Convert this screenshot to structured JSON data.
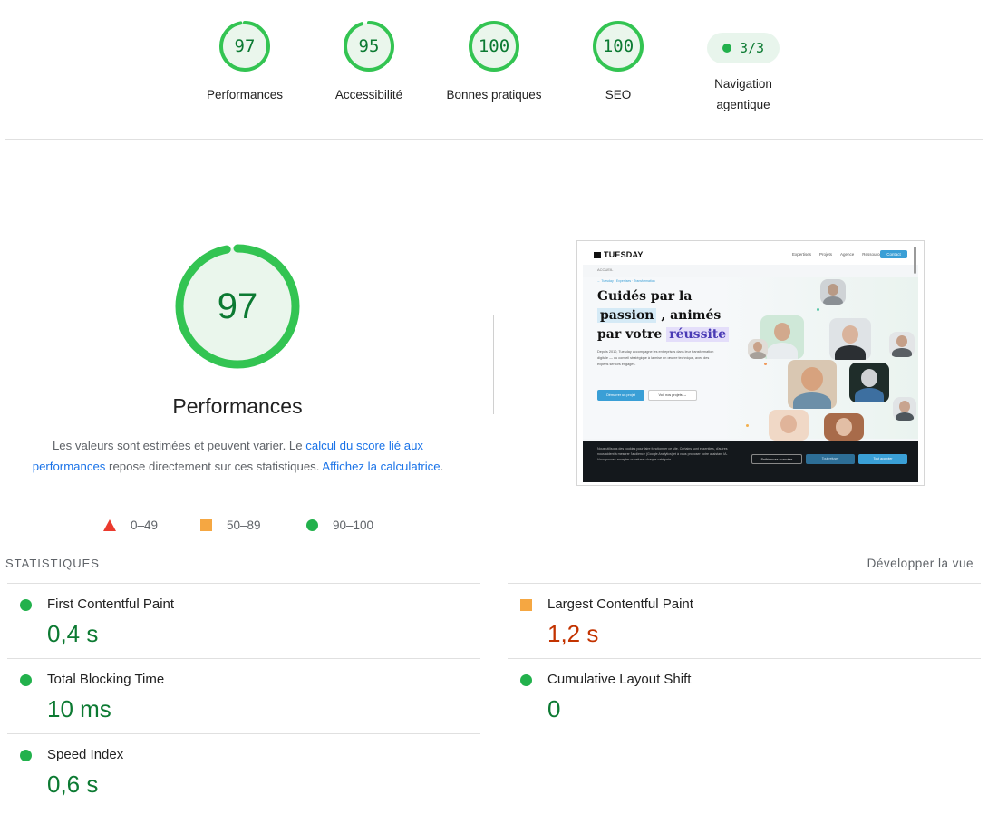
{
  "summary": {
    "items": [
      {
        "score": "97",
        "label": "Performances",
        "score_fraction": 0.97,
        "color": "#0c7a32"
      },
      {
        "score": "95",
        "label": "Accessibilité",
        "score_fraction": 0.95,
        "color": "#0c7a32"
      },
      {
        "score": "100",
        "label": "Bonnes pratiques",
        "score_fraction": 1.0,
        "color": "#0c7a32"
      },
      {
        "score": "100",
        "label": "SEO",
        "score_fraction": 1.0,
        "color": "#0c7a32"
      }
    ],
    "agentic": {
      "badge": "3/3",
      "label_line1": "Navigation",
      "label_line2": "agentique"
    }
  },
  "performance": {
    "score": "97",
    "score_fraction": 0.97,
    "title": "Performances",
    "desc_part1": "Les valeurs sont estimées et peuvent varier. Le ",
    "desc_link1": "calcul du score lié aux performances",
    "desc_part2": " repose directement sur ces statistiques. ",
    "desc_link2": "Affichez la calculatrice",
    "desc_part3": "."
  },
  "legend": {
    "fail": "0–49",
    "average": "50–89",
    "pass": "90–100",
    "colors": {
      "fail": "#eb3a2e",
      "average": "#f5a742",
      "pass": "#22b14c"
    }
  },
  "thumbnail": {
    "logo": "TUESDAY",
    "nav_links": [
      "Expertises",
      "Projets",
      "Agence",
      "Ressources"
    ],
    "nav_cta": "Contact",
    "breadcrumb": "ACCUEIL",
    "crumbs": "← Tuesday · Expertises · Transformation",
    "headline_line1": "Guidés par la",
    "headline_hl1": "passion",
    "headline_line2_rest": " , animés",
    "headline_line3": "par votre ",
    "headline_hl2": "réussite",
    "paragraph": "Depuis 2010, Tuesday accompagne les entreprises dans leur transformation digitale — du conseil stratégique à la mise en œuvre technique, avec des experts seniors engagés.",
    "btn_primary": "Démarrer un projet",
    "btn_secondary": "Voir nos projets →",
    "cookie_text": "Nous utilisons des cookies pour faire fonctionner ce site. Certains sont essentiels, d'autres nous aident à mesurer l'audience (Google Analytics) et à vous proposer notre assistant IA. Vous pouvez accepter ou refuser chaque catégorie.",
    "cookie_btn_prefs": "Préférences avancées",
    "cookie_btn_refuse": "Tout refuser",
    "cookie_btn_accept": "Tout accepter"
  },
  "stats": {
    "heading": "STATISTIQUES",
    "expand_label": "Développer la vue",
    "metrics": [
      {
        "name": "First Contentful Paint",
        "value": "0,4 s",
        "status": "pass"
      },
      {
        "name": "Largest Contentful Paint",
        "value": "1,2 s",
        "status": "average"
      },
      {
        "name": "Total Blocking Time",
        "value": "10 ms",
        "status": "pass"
      },
      {
        "name": "Cumulative Layout Shift",
        "value": "0",
        "status": "pass"
      },
      {
        "name": "Speed Index",
        "value": "0,6 s",
        "status": "pass"
      }
    ]
  }
}
